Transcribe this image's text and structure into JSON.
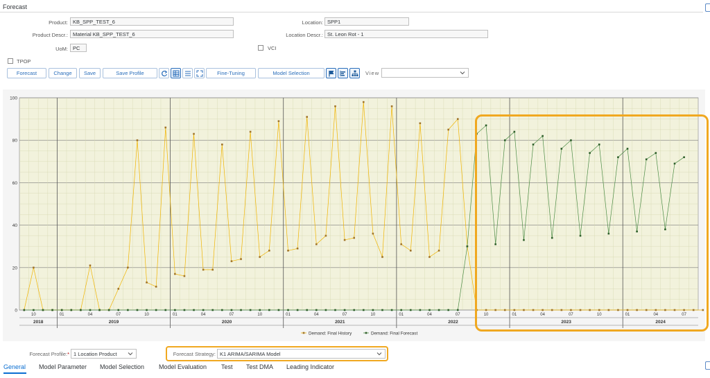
{
  "page": {
    "title": "Forecast"
  },
  "header": {
    "product_label": "Product:",
    "product_value": "KB_SPP_TEST_6",
    "location_label": "Location:",
    "location_value": "SPP1",
    "product_descr_label": "Product Descr.:",
    "product_descr_value": "Material KB_SPP_TEST_6",
    "location_descr_label": "Location Descr.:",
    "location_descr_value": "St. Leon Rot - 1",
    "uom_label": "UoM:",
    "uom_value": "PC",
    "vci_label": "VCI",
    "tpop_label": "TPOP"
  },
  "toolbar": {
    "forecast": "Forecast",
    "change": "Change",
    "save": "Save",
    "save_profile": "Save Profile",
    "fine_tuning": "Fine-Tuning",
    "model_selection": "Model Selection",
    "view_label": "View",
    "view_value": ""
  },
  "icons": [
    "refresh-icon",
    "table-icon",
    "list-icon",
    "expand-icon",
    "flag-icon",
    "bar-list-icon",
    "hierarchy-icon",
    "chevron-down-icon"
  ],
  "colors": {
    "history": "#f0b400",
    "forecast": "#4c8c45",
    "highlight": "#f0a820",
    "accent": "#0a6ed1"
  },
  "chart_data": {
    "type": "line",
    "ylim": [
      0,
      100
    ],
    "yticks": [
      "0",
      "20",
      "40",
      "60",
      "80",
      "100"
    ],
    "grid": true,
    "legend_position": "bottom-center",
    "month_ticks": [
      "10",
      "01",
      "04",
      "07",
      "10",
      "01",
      "04",
      "07",
      "10",
      "01",
      "04",
      "07",
      "10",
      "01",
      "04",
      "07",
      "10",
      "01",
      "04",
      "07",
      "10",
      "01",
      "04",
      "07",
      "10",
      "01",
      "04",
      "07"
    ],
    "years": [
      "2018",
      "2019",
      "2020",
      "2021",
      "2022",
      "2023",
      "2024"
    ],
    "x_range": [
      "2018-09",
      "2024-09"
    ],
    "series": [
      {
        "name": "Demand: Final History",
        "color": "#f0b400",
        "start": "2018-09",
        "values": [
          0,
          20,
          0,
          0,
          0,
          0,
          0,
          21,
          0,
          0,
          10,
          20,
          80,
          13,
          11,
          86,
          17,
          16,
          83,
          19,
          19,
          78,
          23,
          24,
          84,
          25,
          28,
          89,
          28,
          29,
          91,
          31,
          35,
          96,
          33,
          34,
          98,
          36,
          25,
          96,
          31,
          28,
          88,
          25,
          28,
          85,
          90,
          30,
          0,
          0,
          0,
          0,
          0,
          0,
          0,
          0,
          0,
          0,
          0,
          0,
          0,
          0,
          0,
          0,
          0,
          0,
          0,
          0,
          0,
          0,
          0,
          0,
          0
        ]
      },
      {
        "name": "Demand: Final Forecast",
        "color": "#4c8c45",
        "start": "2018-09",
        "values": [
          0,
          0,
          0,
          0,
          0,
          0,
          0,
          0,
          0,
          0,
          0,
          0,
          0,
          0,
          0,
          0,
          0,
          0,
          0,
          0,
          0,
          0,
          0,
          0,
          0,
          0,
          0,
          0,
          0,
          0,
          0,
          0,
          0,
          0,
          0,
          0,
          0,
          0,
          0,
          0,
          0,
          0,
          0,
          0,
          0,
          0,
          0,
          30,
          83,
          87,
          31,
          80,
          84,
          33,
          78,
          82,
          34,
          76,
          80,
          35,
          74,
          78,
          36,
          72,
          76,
          37,
          71,
          74,
          38,
          69,
          72
        ]
      }
    ]
  },
  "bottom": {
    "profile_label": "Forecast Profile:",
    "profile_required": "*",
    "profile_value": "1 Location Product",
    "strategy_label": "Forecast Strategy:",
    "strategy_value": "K1 ARIMA/SARIMA Model",
    "tabs": [
      "General",
      "Model Parameter",
      "Model Selection",
      "Model Evaluation",
      "Test",
      "Test DMA",
      "Leading Indicator"
    ]
  }
}
